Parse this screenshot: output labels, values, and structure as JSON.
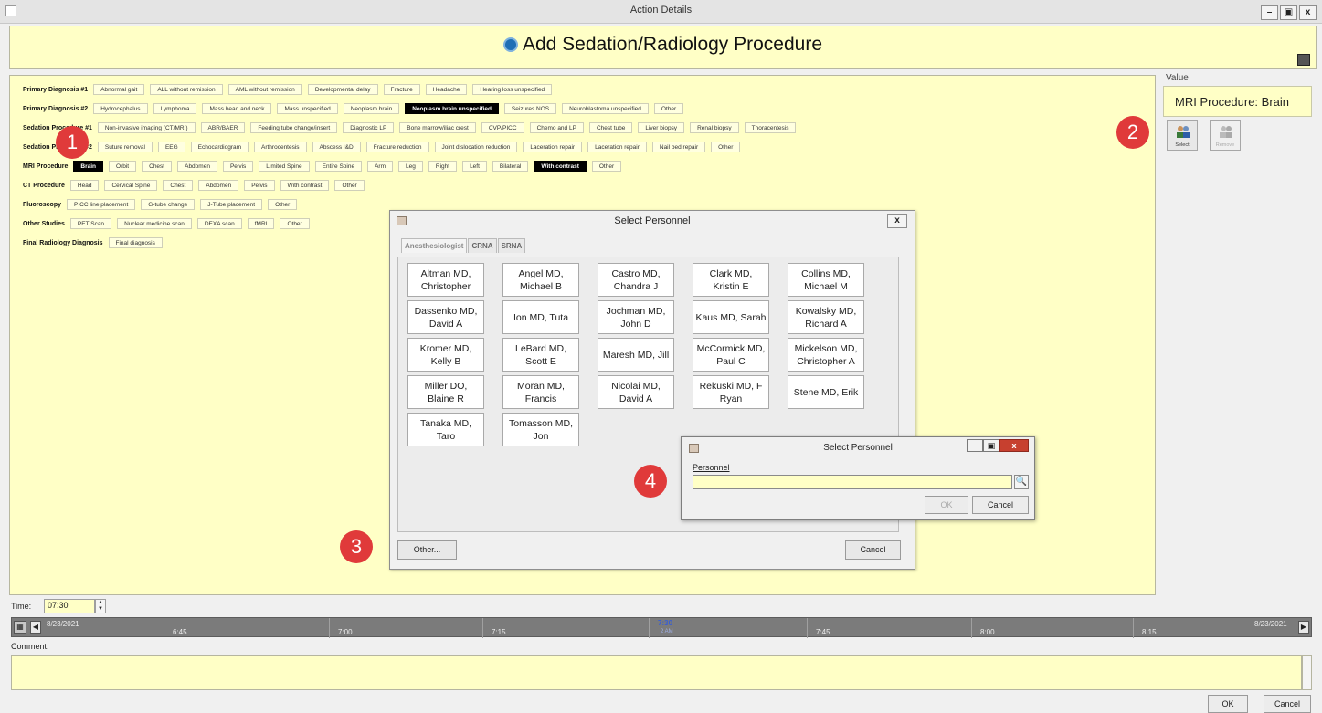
{
  "window": {
    "title": "Action Details"
  },
  "header": {
    "title": "Add Sedation/Radiology Procedure"
  },
  "rows": [
    {
      "label": "Primary Diagnosis #1",
      "options": [
        {
          "text": "Abnormal gait",
          "w": 72
        },
        {
          "text": "ALL without remission",
          "w": 108
        },
        {
          "text": "AML without remission",
          "w": 108
        },
        {
          "text": "Developmental delay",
          "w": 100
        },
        {
          "text": "Fracture",
          "w": 46
        },
        {
          "text": "Headache",
          "w": 54
        },
        {
          "text": "Hearing loss unspecified",
          "w": 116
        }
      ]
    },
    {
      "label": "Primary Diagnosis #2",
      "options": [
        {
          "text": "Hydrocephalus",
          "w": 68
        },
        {
          "text": "Lymphoma",
          "w": 58
        },
        {
          "text": "Mass head and neck",
          "w": 92
        },
        {
          "text": "Mass unspecified",
          "w": 82
        },
        {
          "text": "Neoplasm brain",
          "w": 72
        },
        {
          "text": "Neoplasm brain unspecified",
          "w": 130,
          "selected": true
        },
        {
          "text": "Seizures NOS",
          "w": 68
        },
        {
          "text": "Neuroblastoma unspecified",
          "w": 130
        },
        {
          "text": "Other",
          "w": 36
        }
      ]
    },
    {
      "label": "Sedation Procedure #1",
      "options": [
        {
          "text": "Non-invasive imaging (CT/MRI)",
          "w": 124
        },
        {
          "text": "ABR/BAER",
          "w": 54
        },
        {
          "text": "Feeding tube change/insert",
          "w": 124
        },
        {
          "text": "Diagnostic LP",
          "w": 66
        },
        {
          "text": "Bone marrow/iliac crest",
          "w": 110
        },
        {
          "text": "CVP/PICC",
          "w": 48
        },
        {
          "text": "Chemo and LP",
          "w": 64
        },
        {
          "text": "Chest tube",
          "w": 54
        },
        {
          "text": "Liver biopsy",
          "w": 62
        },
        {
          "text": "Renal biopsy",
          "w": 62
        },
        {
          "text": "Thoracentesis",
          "w": 70
        }
      ]
    },
    {
      "label": "Sedation Procedure #2",
      "options": [
        {
          "text": "Suture removal",
          "w": 74
        },
        {
          "text": "EEG",
          "w": 30
        },
        {
          "text": "Echocardiogram",
          "w": 74
        },
        {
          "text": "Arthrocentesis",
          "w": 72
        },
        {
          "text": "Abscess I&D",
          "w": 60
        },
        {
          "text": "Fracture reduction",
          "w": 90
        },
        {
          "text": "Joint dislocation reduction",
          "w": 126
        },
        {
          "text": "Laceration repair",
          "w": 82
        },
        {
          "text": "Laceration repair",
          "w": 82
        },
        {
          "text": "Nail bed repair",
          "w": 72
        },
        {
          "text": "Other",
          "w": 36
        }
      ]
    },
    {
      "label": "MRI Procedure",
      "options": [
        {
          "text": "Brain",
          "w": 34,
          "selected": true
        },
        {
          "text": "Orbit",
          "w": 36
        },
        {
          "text": "Chest",
          "w": 36
        },
        {
          "text": "Abdomen",
          "w": 52
        },
        {
          "text": "Pelvis",
          "w": 40
        },
        {
          "text": "Limited Spine",
          "w": 68
        },
        {
          "text": "Entire Spine",
          "w": 64
        },
        {
          "text": "Arm",
          "w": 30
        },
        {
          "text": "Leg",
          "w": 28
        },
        {
          "text": "Right",
          "w": 32
        },
        {
          "text": "Left",
          "w": 28
        },
        {
          "text": "Bilateral",
          "w": 46
        },
        {
          "text": "With contrast",
          "w": 74,
          "selected": true
        },
        {
          "text": "Other",
          "w": 36
        }
      ]
    },
    {
      "label": "CT Procedure",
      "options": [
        {
          "text": "Head",
          "w": 32
        },
        {
          "text": "Cervical Spine",
          "w": 66
        },
        {
          "text": "Chest",
          "w": 36
        },
        {
          "text": "Abdomen",
          "w": 52
        },
        {
          "text": "Pelvis",
          "w": 40
        },
        {
          "text": "With contrast",
          "w": 68
        },
        {
          "text": "Other",
          "w": 36
        }
      ]
    },
    {
      "label": "Fluoroscopy",
      "options": [
        {
          "text": "PICC line placement",
          "w": 96
        },
        {
          "text": "G-tube change",
          "w": 72
        },
        {
          "text": "J-Tube placement",
          "w": 86
        },
        {
          "text": "Other",
          "w": 36
        }
      ]
    },
    {
      "label": "Other Studies",
      "options": [
        {
          "text": "PET Scan",
          "w": 46
        },
        {
          "text": "Nuclear medicine scan",
          "w": 106
        },
        {
          "text": "DEXA scan",
          "w": 56
        },
        {
          "text": "fMRI",
          "w": 34
        },
        {
          "text": "Other",
          "w": 36
        }
      ]
    },
    {
      "label": "Final Radiology Diagnosis",
      "options": [
        {
          "text": "Final diagnosis",
          "w": 74
        }
      ]
    }
  ],
  "value_panel": {
    "label": "Value",
    "value": "MRI Procedure:  Brain",
    "select_label": "Select",
    "remove_label": "Remove"
  },
  "callouts": [
    "1",
    "2",
    "3",
    "4"
  ],
  "dialog1": {
    "title": "Select Personnel",
    "close": "x",
    "tabs": [
      "Anesthesiologist",
      "CRNA",
      "SRNA"
    ],
    "personnel": [
      "Altman MD, Christopher",
      "Angel MD, Michael B",
      "Castro MD, Chandra J",
      "Clark MD, Kristin E",
      "Collins MD, Michael M",
      "Dassenko MD, David A",
      "Ion MD, Tuta",
      "Jochman MD, John D",
      "Kaus MD, Sarah",
      "Kowalsky MD, Richard A",
      "Kromer MD, Kelly B",
      "LeBard MD, Scott E",
      "Maresh MD, Jill",
      "McCormick MD, Paul C",
      "Mickelson MD, Christopher A",
      "Miller DO, Blaine R",
      "Moran MD, Francis",
      "Nicolai MD, David A",
      "Rekuski MD, F Ryan",
      "Stene MD, Erik",
      "Tanaka MD, Taro",
      "Tomasson MD, Jon"
    ],
    "other_label": "Other...",
    "cancel_label": "Cancel"
  },
  "dialog2": {
    "title": "Select Personnel",
    "field_label": "Personnel",
    "field_value": "",
    "ok_label": "OK",
    "cancel_label": "Cancel"
  },
  "time": {
    "label": "Time:",
    "value": "07:30"
  },
  "timeline": {
    "start_date": "8/23/2021",
    "end_date": "8/23/2021",
    "ticks": [
      "6:45",
      "7:00",
      "7:15",
      "7:30",
      "7:45",
      "8:00",
      "8:15"
    ],
    "current": "7:30",
    "current_sub": "2 AM"
  },
  "comment": {
    "label": "Comment:",
    "value": ""
  },
  "footer": {
    "ok_label": "OK",
    "cancel_label": "Cancel"
  },
  "colors": {
    "panel_yellow": "#ffffc6",
    "selected_chip": "#000000",
    "callout_red": "#e03a3a"
  }
}
